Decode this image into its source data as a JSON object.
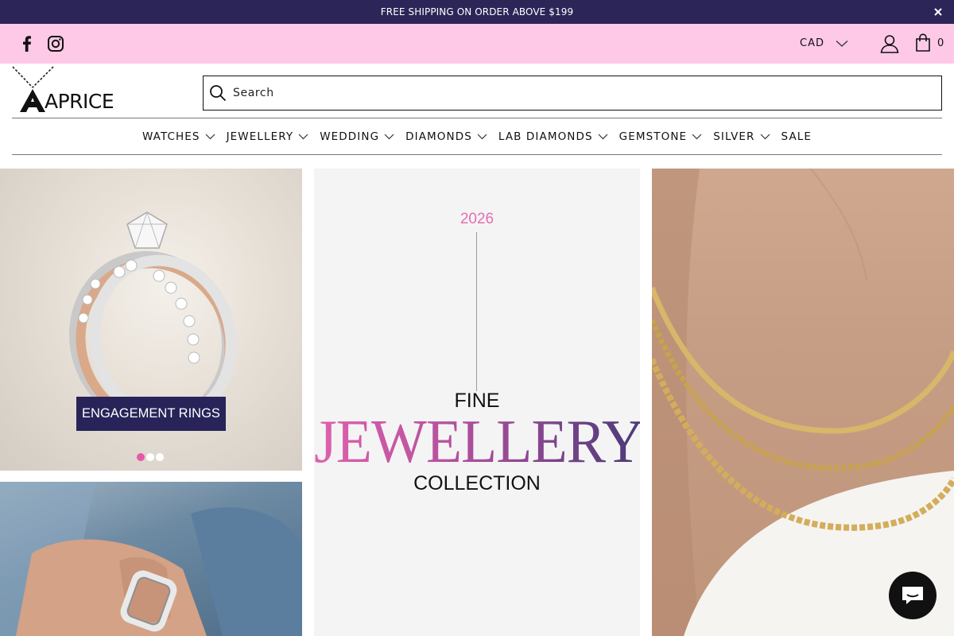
{
  "announcement": {
    "text": "FREE SHIPPING ON ORDER ABOVE $199",
    "close_icon": "close-icon"
  },
  "utility": {
    "social": [
      "facebook-icon",
      "instagram-icon"
    ],
    "currency": "CAD",
    "cart_count": "0"
  },
  "logo": {
    "text": "APRICE"
  },
  "search": {
    "placeholder": "Search"
  },
  "nav": {
    "items": [
      {
        "label": "WATCHES",
        "has_dropdown": true
      },
      {
        "label": "JEWELLERY",
        "has_dropdown": true
      },
      {
        "label": "WEDDING",
        "has_dropdown": true
      },
      {
        "label": "DIAMONDS",
        "has_dropdown": true
      },
      {
        "label": "LAB DIAMONDS",
        "has_dropdown": true
      },
      {
        "label": "GEMSTONE",
        "has_dropdown": true
      },
      {
        "label": "SILVER",
        "has_dropdown": true
      },
      {
        "label": "SALE",
        "has_dropdown": false
      }
    ]
  },
  "hero": {
    "left": {
      "cta_label": "ENGAGEMENT RINGS",
      "slide_count": 3,
      "active_slide": 1
    },
    "center": {
      "year": "2026",
      "line1": "FINE",
      "line2": "JEWELLERY",
      "line3": "COLLECTION"
    }
  },
  "colors": {
    "announcement_bg": "#2b2558",
    "utility_bg": "#fdc9e7",
    "accent_pink": "#e55aa8",
    "cta_bg": "#282459"
  }
}
